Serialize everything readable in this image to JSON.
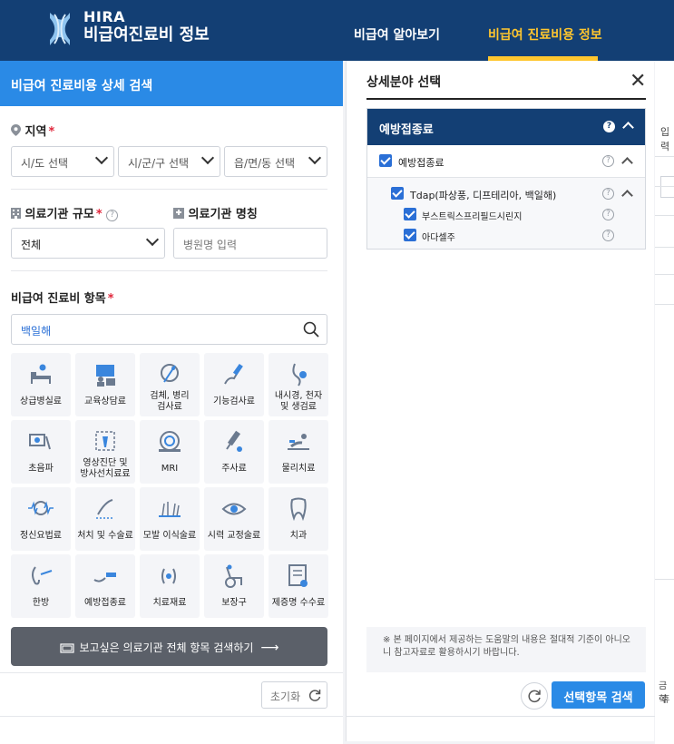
{
  "header": {
    "logo_en": "HIRA",
    "logo_ko": "비급여진료비 정보",
    "nav": [
      {
        "label": "비급여 알아보기",
        "active": false
      },
      {
        "label": "비급여 진료비용 정보",
        "active": true
      }
    ],
    "accent_color": "#ffc62e",
    "bg_color": "#133f74"
  },
  "left_panel": {
    "title": "비급여 진료비용 상세 검색",
    "region": {
      "label": "지역",
      "required_mark": "*",
      "selects": [
        "시/도 선택",
        "시/군/구 선택",
        "읍/면/동 선택"
      ]
    },
    "scale": {
      "label": "의료기관 규모",
      "required_mark": "*",
      "value": "전체"
    },
    "hospital_name": {
      "label": "의료기관 명칭",
      "placeholder": "병원명 입력"
    },
    "items": {
      "label": "비급여 진료비 항목",
      "required_mark": "*",
      "search_value": "백일해"
    },
    "categories": [
      {
        "name": "bed",
        "label": "상급병실료",
        "label2": ""
      },
      {
        "name": "consult",
        "label": "교육상담료",
        "label2": ""
      },
      {
        "name": "pathology",
        "label": "검체, 병리",
        "label2": "검사료"
      },
      {
        "name": "function",
        "label": "기능검사료",
        "label2": ""
      },
      {
        "name": "endoscope",
        "label": "내시경, 천자",
        "label2": "및 생검료"
      },
      {
        "name": "ultrasound",
        "label": "초음파",
        "label2": ""
      },
      {
        "name": "radiology",
        "label": "영상진단 및",
        "label2": "방사선치료료"
      },
      {
        "name": "mri",
        "label": "MRI",
        "label2": ""
      },
      {
        "name": "injection",
        "label": "주사료",
        "label2": ""
      },
      {
        "name": "physio",
        "label": "물리치료",
        "label2": ""
      },
      {
        "name": "psych",
        "label": "정신요법료",
        "label2": ""
      },
      {
        "name": "surgery",
        "label": "처치 및 수술료",
        "label2": ""
      },
      {
        "name": "hair",
        "label": "모발 이식술료",
        "label2": ""
      },
      {
        "name": "vision",
        "label": "시력 교정술료",
        "label2": ""
      },
      {
        "name": "dental",
        "label": "치과",
        "label2": ""
      },
      {
        "name": "oriental",
        "label": "한방",
        "label2": ""
      },
      {
        "name": "vaccine",
        "label": "예방접종료",
        "label2": ""
      },
      {
        "name": "material",
        "label": "치료재료",
        "label2": ""
      },
      {
        "name": "device",
        "label": "보장구",
        "label2": ""
      },
      {
        "name": "certificate",
        "label": "제증명 수수료",
        "label2": ""
      }
    ],
    "all_items_button": "보고싶은 의료기관 전체 항목 검색하기",
    "reset_button": "초기화"
  },
  "right_panel": {
    "title": "상세분야 선택",
    "group_title": "예방접종료",
    "level1": {
      "label": "예방접종료",
      "checked": true
    },
    "level2": {
      "label": "Tdap(파상풍, 디프테리아, 백일해)",
      "checked": true
    },
    "level3": [
      {
        "label": "부스트릭스프리필드시린지",
        "checked": true
      },
      {
        "label": "아다셀주",
        "checked": true
      }
    ],
    "note_line1": "※ 본 페이지에서 제공하는 도움말의 내용은 절대적 기준이 아니오",
    "note_line2": "니 참고자료로 활용하시기 바랍니다.",
    "search_button": "선택항목 검색"
  },
  "background": {
    "strip_texts": [
      "입력",
      "금학",
      "·휴"
    ]
  }
}
